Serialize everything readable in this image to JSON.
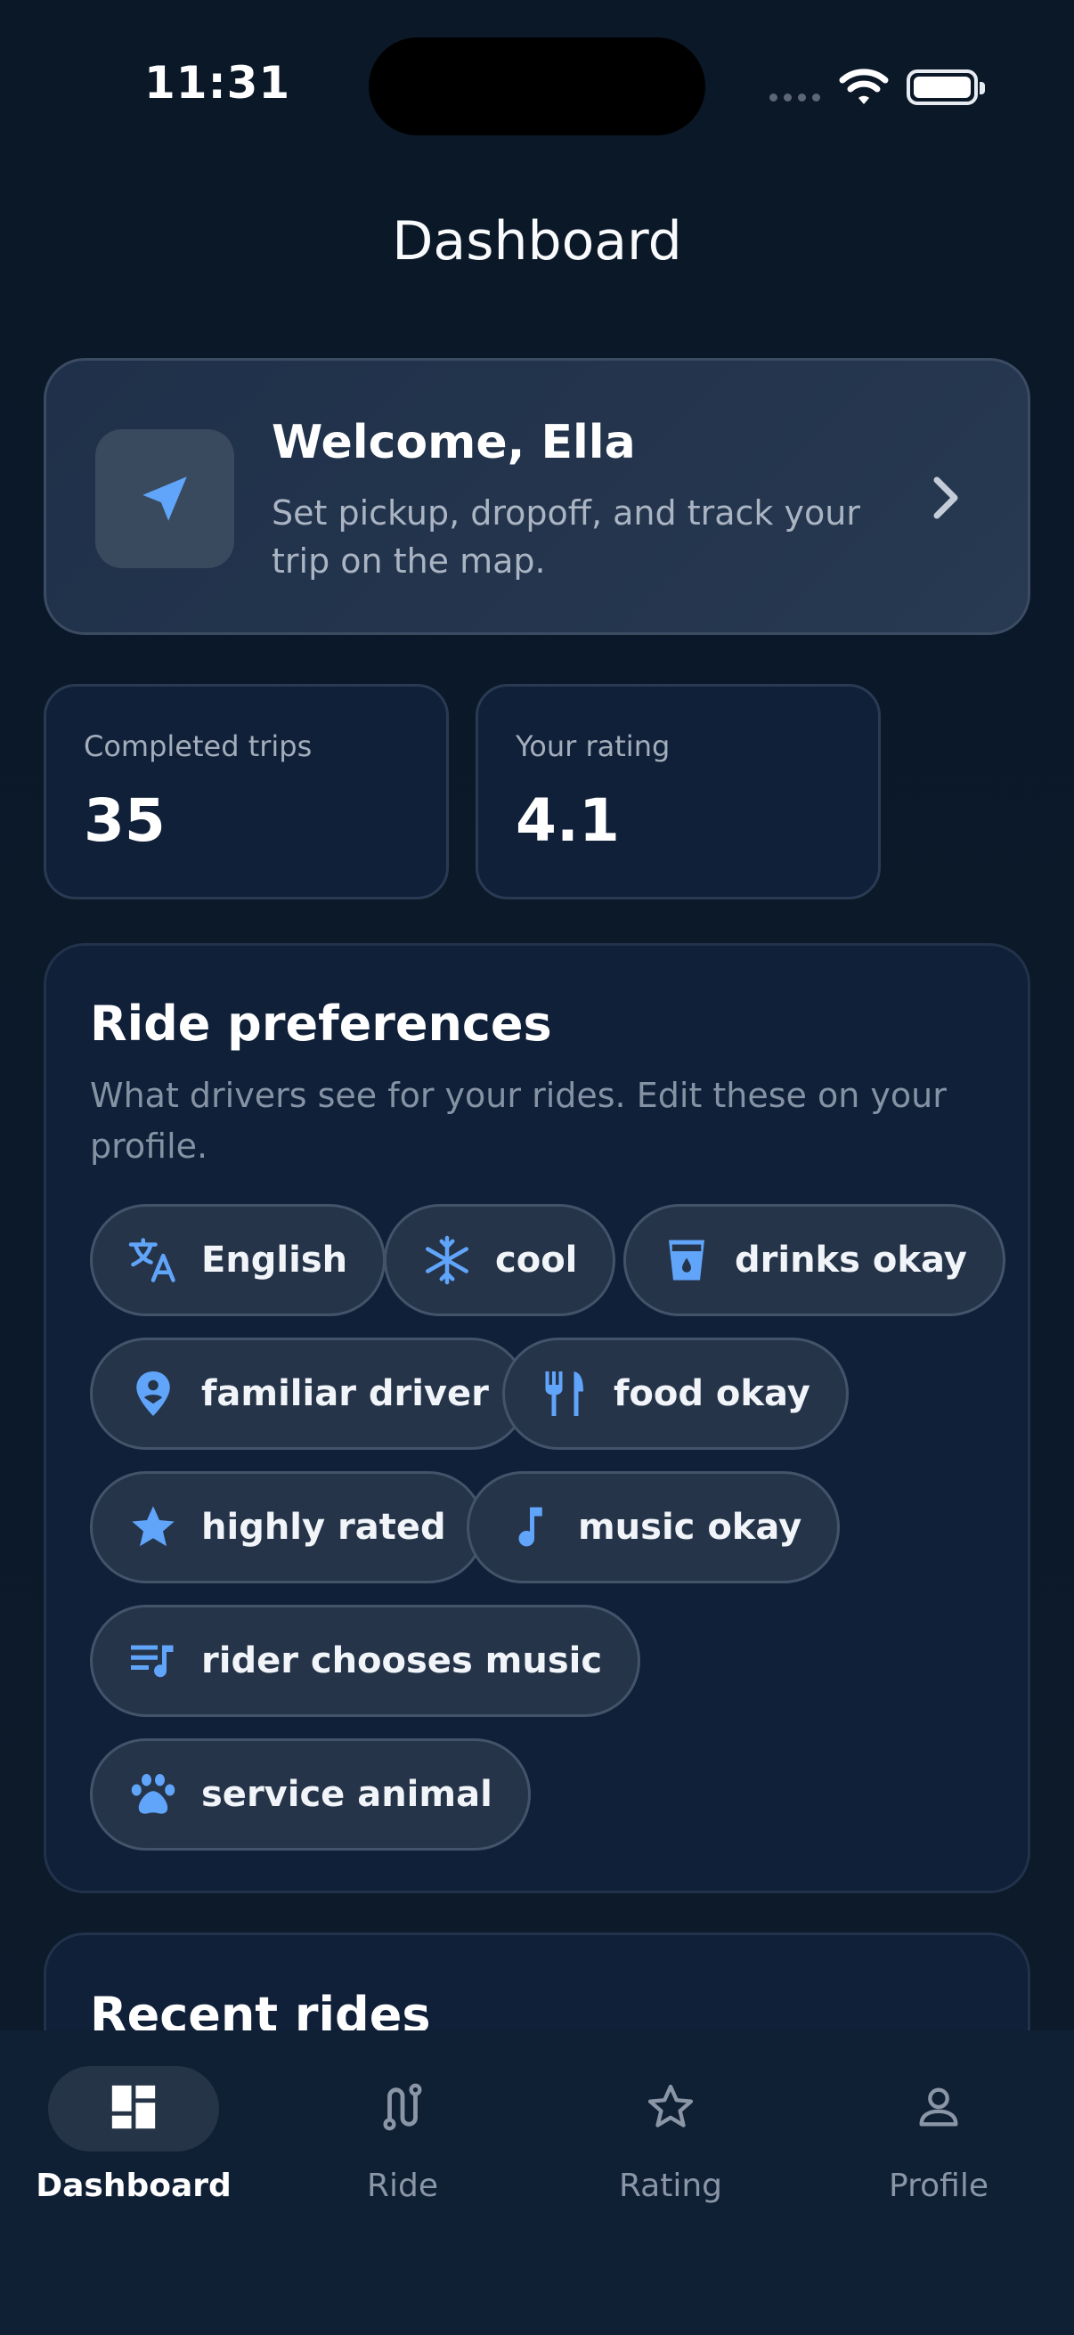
{
  "status_bar": {
    "time": "11:31"
  },
  "header": {
    "title": "Dashboard"
  },
  "welcome_card": {
    "title": "Welcome, Ella",
    "subtitle": "Set pickup, dropoff, and track your trip on the map.",
    "icon": "navigation-arrow-icon"
  },
  "stats": [
    {
      "label": "Completed trips",
      "value": "35"
    },
    {
      "label": "Your rating",
      "value": "4.1"
    }
  ],
  "preferences": {
    "title": "Ride preferences",
    "subtitle": "What drivers see for your rides. Edit these on your profile.",
    "chips": [
      {
        "label": "English",
        "icon": "translate-icon"
      },
      {
        "label": "cool",
        "icon": "snowflake-icon"
      },
      {
        "label": "drinks okay",
        "icon": "cup-icon"
      },
      {
        "label": "familiar driver",
        "icon": "person-pin-icon"
      },
      {
        "label": "food okay",
        "icon": "utensils-icon"
      },
      {
        "label": "highly rated",
        "icon": "star-icon"
      },
      {
        "label": "music okay",
        "icon": "music-note-icon"
      },
      {
        "label": "rider chooses music",
        "icon": "playlist-icon"
      },
      {
        "label": "service animal",
        "icon": "paw-icon"
      }
    ]
  },
  "recent_rides": {
    "title": "Recent rides"
  },
  "tabs": [
    {
      "label": "Dashboard",
      "icon": "dashboard-icon",
      "active": true
    },
    {
      "label": "Ride",
      "icon": "route-icon",
      "active": false
    },
    {
      "label": "Rating",
      "icon": "star-outline-icon",
      "active": false
    },
    {
      "label": "Profile",
      "icon": "person-icon",
      "active": false
    }
  ],
  "colors": {
    "accent": "#60a5fa",
    "background": "#0b1828",
    "card": "#102038"
  }
}
